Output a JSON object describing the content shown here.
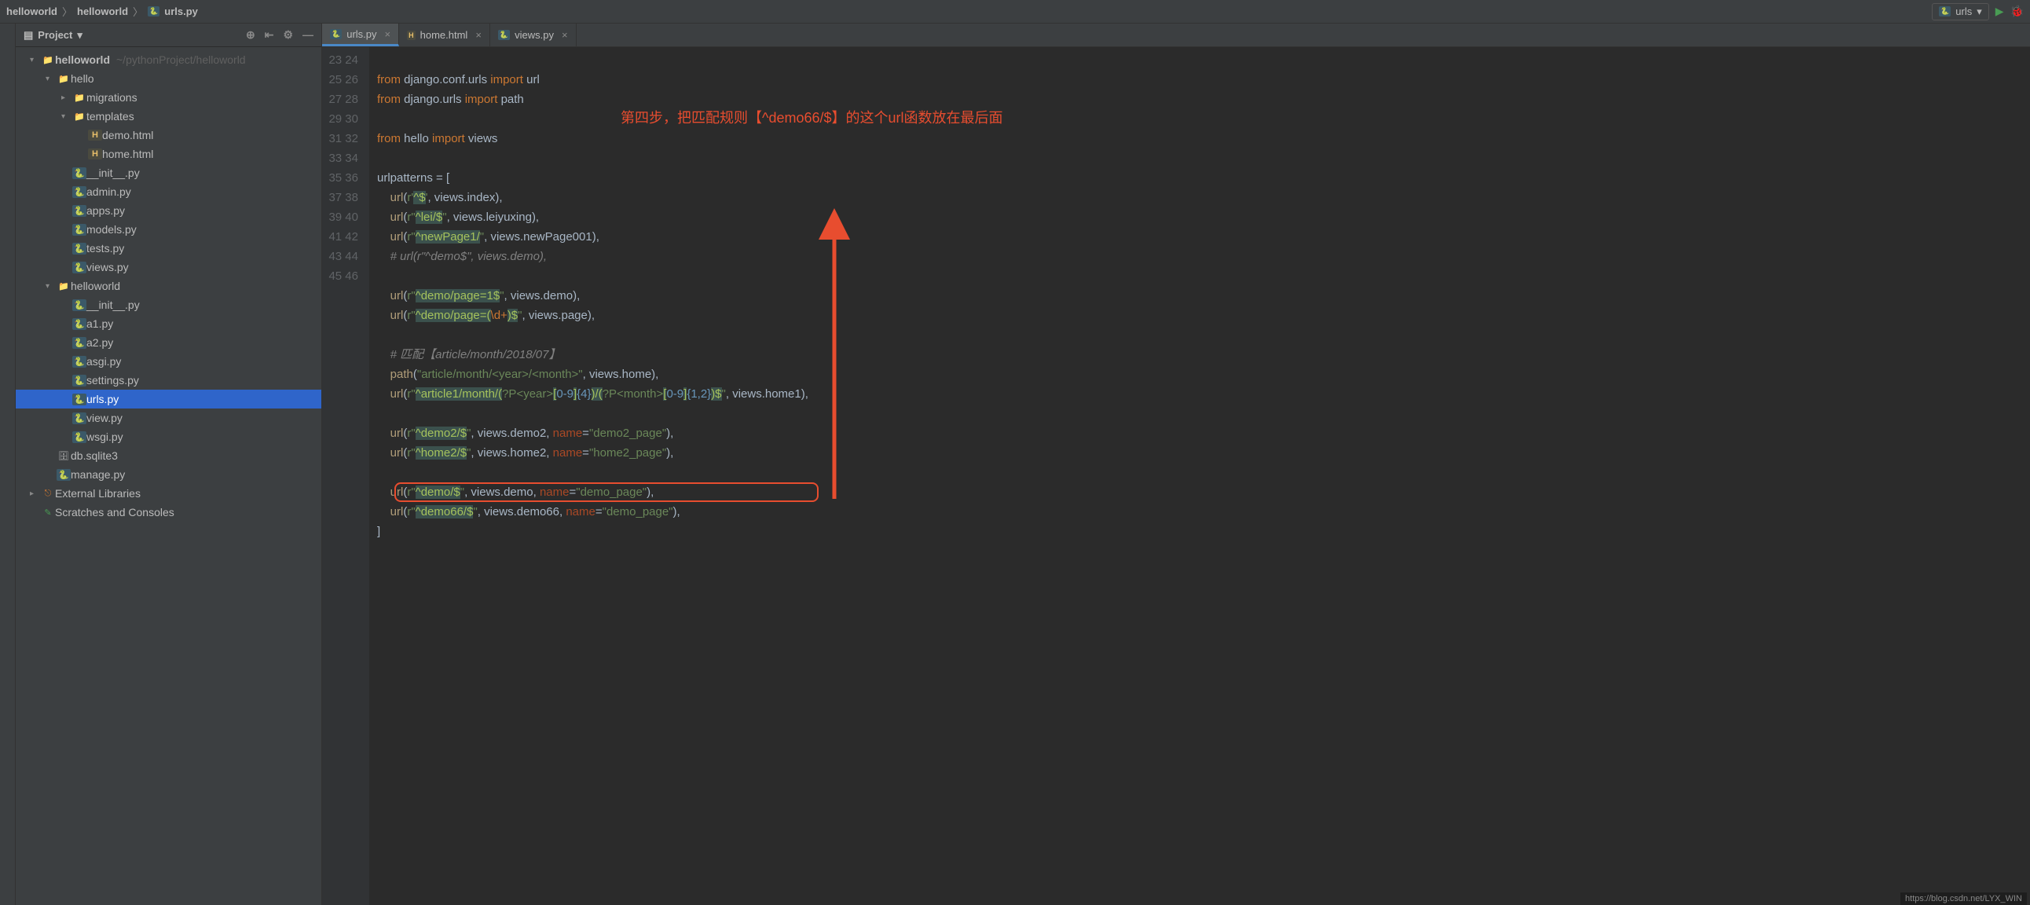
{
  "breadcrumb": {
    "p1": "helloworld",
    "p2": "helloworld",
    "p3": "urls.py"
  },
  "run_config": {
    "label": "urls"
  },
  "project_header": {
    "title": "Project"
  },
  "tree": {
    "root": {
      "name": "helloworld",
      "path": "~/pythonProject/helloworld"
    },
    "hello": "hello",
    "migrations": "migrations",
    "templates": "templates",
    "demo_html": "demo.html",
    "home_html": "home.html",
    "init_py": "__init__.py",
    "admin_py": "admin.py",
    "apps_py": "apps.py",
    "models_py": "models.py",
    "tests_py": "tests.py",
    "views_py": "views.py",
    "helloworld2": "helloworld",
    "init_py2": "__init__.py",
    "a1_py": "a1.py",
    "a2_py": "a2.py",
    "asgi_py": "asgi.py",
    "settings_py": "settings.py",
    "urls_py": "urls.py",
    "view_py": "view.py",
    "wsgi_py": "wsgi.py",
    "db": "db.sqlite3",
    "manage_py": "manage.py",
    "external": "External Libraries",
    "scratches": "Scratches and Consoles"
  },
  "tabs": {
    "t1": "urls.py",
    "t2": "home.html",
    "t3": "views.py"
  },
  "annotation_text": "第四步，把匹配规则【^demo66/$】的这个url函数放在最后面",
  "footer": "https://blog.csdn.net/LYX_WIN",
  "code": {
    "lines": [
      23,
      24,
      25,
      26,
      27,
      28,
      29,
      30,
      31,
      32,
      33,
      34,
      35,
      36,
      37,
      38,
      39,
      40,
      41,
      42,
      43,
      44,
      45,
      46
    ],
    "l23": "from django.conf.urls import url",
    "l24": "from django.urls import path",
    "l26": "from hello import views",
    "l28": "urlpatterns = [",
    "l29": "    url(r'^$', views.index),",
    "l30": "    url(r\"^lei/$\", views.leiyuxing),",
    "l31": "    url(r\"^newPage1/\", views.newPage001),",
    "l32": "    # url(r\"^demo$\", views.demo),",
    "l34": "    url(r\"^demo/page=1$\", views.demo),",
    "l35": "    url(r\"^demo/page=(\\d+)$\", views.page),",
    "l37": "    # 匹配【article/month/2018/07】",
    "l38": "    path(\"article/month/<year>/<month>\", views.home),",
    "l39": "    url(r\"^article1/month/(?P<year>[0-9]{4})/(?P<month>[0-9]{1,2})$\", views.home1),",
    "l41": "    url(r\"^demo2/$\", views.demo2, name=\"demo2_page\"),",
    "l42": "    url(r\"^home2/$\", views.home2, name=\"home2_page\"),",
    "l44": "    url(r\"^demo/$\", views.demo, name=\"demo_page\"),",
    "l45": "    url(r\"^demo66/$\", views.demo66, name=\"demo_page\"),",
    "l46": "]"
  }
}
